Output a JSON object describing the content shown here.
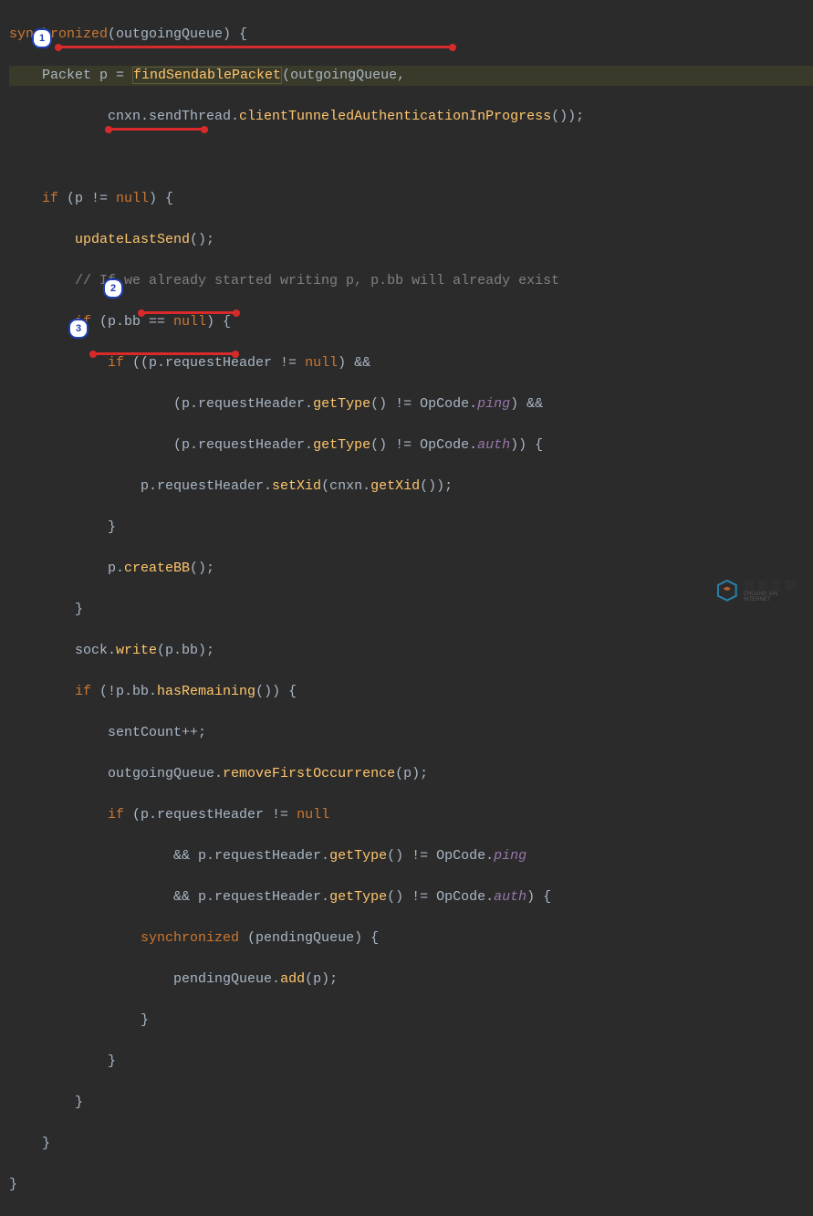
{
  "code": {
    "l1a": "synchronized",
    "l1b": "(outgoingQueue) {",
    "l2a": "    Packet p = ",
    "l2b": "findSendablePacket",
    "l2c": "(outgoingQueue,",
    "l3a": "            cnxn.sendThread.",
    "l3b": "clientTunneledAuthenticationInProgress",
    "l3c": "());",
    "l5a": "    if",
    "l5b": " (p != ",
    "l5c": "null",
    "l5d": ") {",
    "l6a": "        updateLastSend",
    "l6b": "();",
    "l7": "        // If we already started writing p, p.bb will already exist",
    "l8a": "        if",
    "l8b": " (p.bb == ",
    "l8c": "null",
    "l8d": ") {",
    "l9a": "            if",
    "l9b": " ((p.requestHeader != ",
    "l9c": "null",
    "l9d": ") &&",
    "l10a": "                    (p.requestHeader.",
    "l10b": "getType",
    "l10c": "() != OpCode.",
    "l10d": "ping",
    "l10e": ") &&",
    "l11a": "                    (p.requestHeader.",
    "l11b": "getType",
    "l11c": "() != OpCode.",
    "l11d": "auth",
    "l11e": ")) {",
    "l12a": "                p.requestHeader.",
    "l12b": "setXid",
    "l12c": "(cnxn.",
    "l12d": "getXid",
    "l12e": "());",
    "l13": "            }",
    "l14a": "            p.",
    "l14b": "createBB",
    "l14c": "();",
    "l15": "        }",
    "l16a": "        sock.",
    "l16b": "write",
    "l16c": "(p.bb);",
    "l17a": "        if",
    "l17b": " (!p.bb.",
    "l17c": "hasRemaining",
    "l17d": "()) {",
    "l18": "            sentCount++;",
    "l19a": "            outgoingQueue.",
    "l19b": "removeFirstOccurrence",
    "l19c": "(p);",
    "l20a": "            if",
    "l20b": " (p.requestHeader != ",
    "l20c": "null",
    "l21a": "                    && p.requestHeader.",
    "l21b": "getType",
    "l21c": "() != OpCode.",
    "l21d": "ping",
    "l22a": "                    && p.requestHeader.",
    "l22b": "getType",
    "l22c": "() != OpCode.",
    "l22d": "auth",
    "l22e": ") {",
    "l23a": "                synchronized",
    "l23b": " (pendingQueue) {",
    "l24a": "                    pendingQueue.",
    "l24b": "add",
    "l24c": "(p);",
    "l25": "                }",
    "l26": "            }",
    "l27": "        }",
    "l28": "    }",
    "l29": "}"
  },
  "bullets": {
    "b1": "1",
    "b2": "2",
    "b3": "3"
  },
  "watermark": {
    "cn": "创新互联",
    "en": "CHUANG XIN INTERNET"
  }
}
